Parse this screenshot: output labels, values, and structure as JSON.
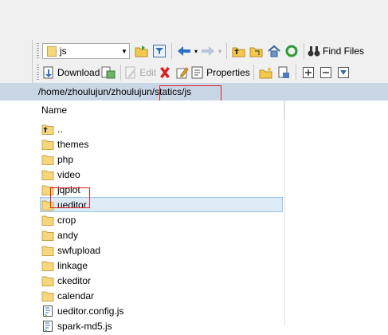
{
  "toolbar": {
    "folder_combo": {
      "value": "js"
    },
    "find_files_label": "Find Files",
    "download_label": "Download",
    "edit_label": "Edit",
    "properties_label": "Properties"
  },
  "path_bar": {
    "prefix": "/home/zhoulujun/zhoulujun",
    "highlighted": "/statics/js"
  },
  "file_list": {
    "column_name": "Name",
    "items": [
      {
        "name": "..",
        "type": "parent"
      },
      {
        "name": "themes",
        "type": "folder"
      },
      {
        "name": "php",
        "type": "folder"
      },
      {
        "name": "video",
        "type": "folder"
      },
      {
        "name": "jqplot",
        "type": "folder"
      },
      {
        "name": "ueditor",
        "type": "folder",
        "selected": true
      },
      {
        "name": "crop",
        "type": "folder"
      },
      {
        "name": "andy",
        "type": "folder"
      },
      {
        "name": "swfupload",
        "type": "folder"
      },
      {
        "name": "linkage",
        "type": "folder"
      },
      {
        "name": "ckeditor",
        "type": "folder"
      },
      {
        "name": "calendar",
        "type": "folder"
      },
      {
        "name": "ueditor.config.js",
        "type": "file"
      },
      {
        "name": "spark-md5.js",
        "type": "file"
      }
    ]
  },
  "colors": {
    "path_bar_bg": "#c8d6e6",
    "selection_bg": "#ddebf7",
    "highlight_box": "#e02020",
    "folder": "#f5d77c"
  }
}
